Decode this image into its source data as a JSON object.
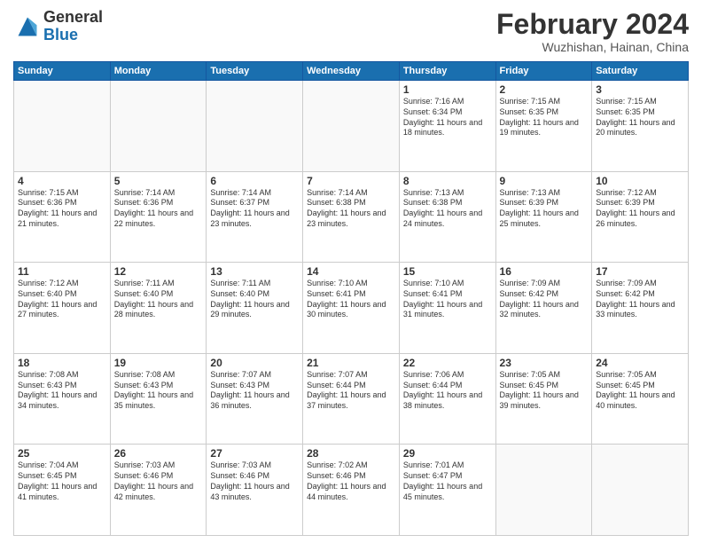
{
  "header": {
    "logo_general": "General",
    "logo_blue": "Blue",
    "month_title": "February 2024",
    "location": "Wuzhishan, Hainan, China"
  },
  "days_of_week": [
    "Sunday",
    "Monday",
    "Tuesday",
    "Wednesday",
    "Thursday",
    "Friday",
    "Saturday"
  ],
  "weeks": [
    [
      {
        "day": "",
        "info": "",
        "empty": true
      },
      {
        "day": "",
        "info": "",
        "empty": true
      },
      {
        "day": "",
        "info": "",
        "empty": true
      },
      {
        "day": "",
        "info": "",
        "empty": true
      },
      {
        "day": "1",
        "info": "Sunrise: 7:16 AM\nSunset: 6:34 PM\nDaylight: 11 hours and 18 minutes."
      },
      {
        "day": "2",
        "info": "Sunrise: 7:15 AM\nSunset: 6:35 PM\nDaylight: 11 hours and 19 minutes."
      },
      {
        "day": "3",
        "info": "Sunrise: 7:15 AM\nSunset: 6:35 PM\nDaylight: 11 hours and 20 minutes."
      }
    ],
    [
      {
        "day": "4",
        "info": "Sunrise: 7:15 AM\nSunset: 6:36 PM\nDaylight: 11 hours and 21 minutes."
      },
      {
        "day": "5",
        "info": "Sunrise: 7:14 AM\nSunset: 6:36 PM\nDaylight: 11 hours and 22 minutes."
      },
      {
        "day": "6",
        "info": "Sunrise: 7:14 AM\nSunset: 6:37 PM\nDaylight: 11 hours and 23 minutes."
      },
      {
        "day": "7",
        "info": "Sunrise: 7:14 AM\nSunset: 6:38 PM\nDaylight: 11 hours and 23 minutes."
      },
      {
        "day": "8",
        "info": "Sunrise: 7:13 AM\nSunset: 6:38 PM\nDaylight: 11 hours and 24 minutes."
      },
      {
        "day": "9",
        "info": "Sunrise: 7:13 AM\nSunset: 6:39 PM\nDaylight: 11 hours and 25 minutes."
      },
      {
        "day": "10",
        "info": "Sunrise: 7:12 AM\nSunset: 6:39 PM\nDaylight: 11 hours and 26 minutes."
      }
    ],
    [
      {
        "day": "11",
        "info": "Sunrise: 7:12 AM\nSunset: 6:40 PM\nDaylight: 11 hours and 27 minutes."
      },
      {
        "day": "12",
        "info": "Sunrise: 7:11 AM\nSunset: 6:40 PM\nDaylight: 11 hours and 28 minutes."
      },
      {
        "day": "13",
        "info": "Sunrise: 7:11 AM\nSunset: 6:40 PM\nDaylight: 11 hours and 29 minutes."
      },
      {
        "day": "14",
        "info": "Sunrise: 7:10 AM\nSunset: 6:41 PM\nDaylight: 11 hours and 30 minutes."
      },
      {
        "day": "15",
        "info": "Sunrise: 7:10 AM\nSunset: 6:41 PM\nDaylight: 11 hours and 31 minutes."
      },
      {
        "day": "16",
        "info": "Sunrise: 7:09 AM\nSunset: 6:42 PM\nDaylight: 11 hours and 32 minutes."
      },
      {
        "day": "17",
        "info": "Sunrise: 7:09 AM\nSunset: 6:42 PM\nDaylight: 11 hours and 33 minutes."
      }
    ],
    [
      {
        "day": "18",
        "info": "Sunrise: 7:08 AM\nSunset: 6:43 PM\nDaylight: 11 hours and 34 minutes."
      },
      {
        "day": "19",
        "info": "Sunrise: 7:08 AM\nSunset: 6:43 PM\nDaylight: 11 hours and 35 minutes."
      },
      {
        "day": "20",
        "info": "Sunrise: 7:07 AM\nSunset: 6:43 PM\nDaylight: 11 hours and 36 minutes."
      },
      {
        "day": "21",
        "info": "Sunrise: 7:07 AM\nSunset: 6:44 PM\nDaylight: 11 hours and 37 minutes."
      },
      {
        "day": "22",
        "info": "Sunrise: 7:06 AM\nSunset: 6:44 PM\nDaylight: 11 hours and 38 minutes."
      },
      {
        "day": "23",
        "info": "Sunrise: 7:05 AM\nSunset: 6:45 PM\nDaylight: 11 hours and 39 minutes."
      },
      {
        "day": "24",
        "info": "Sunrise: 7:05 AM\nSunset: 6:45 PM\nDaylight: 11 hours and 40 minutes."
      }
    ],
    [
      {
        "day": "25",
        "info": "Sunrise: 7:04 AM\nSunset: 6:45 PM\nDaylight: 11 hours and 41 minutes."
      },
      {
        "day": "26",
        "info": "Sunrise: 7:03 AM\nSunset: 6:46 PM\nDaylight: 11 hours and 42 minutes."
      },
      {
        "day": "27",
        "info": "Sunrise: 7:03 AM\nSunset: 6:46 PM\nDaylight: 11 hours and 43 minutes."
      },
      {
        "day": "28",
        "info": "Sunrise: 7:02 AM\nSunset: 6:46 PM\nDaylight: 11 hours and 44 minutes."
      },
      {
        "day": "29",
        "info": "Sunrise: 7:01 AM\nSunset: 6:47 PM\nDaylight: 11 hours and 45 minutes."
      },
      {
        "day": "",
        "info": "",
        "empty": true
      },
      {
        "day": "",
        "info": "",
        "empty": true
      }
    ]
  ]
}
